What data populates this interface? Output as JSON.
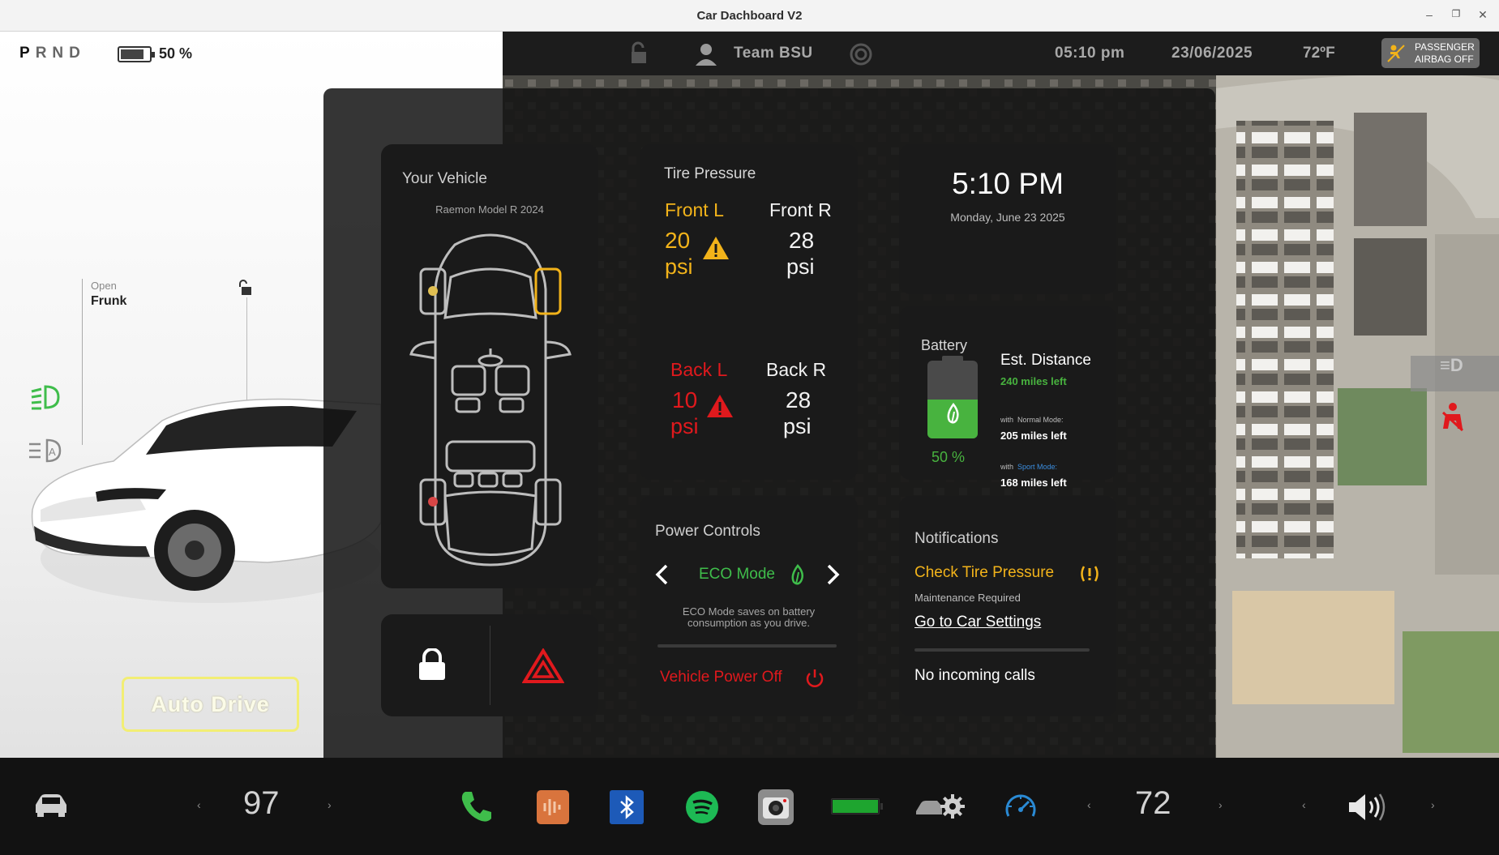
{
  "window": {
    "title": "Car Dachboard V2"
  },
  "gear": {
    "letters": [
      "P",
      "R",
      "N",
      "D"
    ],
    "selected": "P"
  },
  "battery_top": {
    "label": "50 %",
    "level": 0.5
  },
  "frunk": {
    "state": "Open",
    "label": "Frunk"
  },
  "auto_drive": {
    "label": "Auto Drive"
  },
  "topbar": {
    "profile": "Team BSU",
    "time": "05:10 pm",
    "date": "23/06/2025",
    "temp": "72ºF",
    "airbag_line1": "PASSENGER",
    "airbag_line2": "AIRBAG OFF"
  },
  "vehicle": {
    "title": "Your Vehicle",
    "model": "Raemon Model R 2024"
  },
  "tire": {
    "title": "Tire Pressure",
    "front_l": {
      "label": "Front L",
      "value": "20",
      "unit": "psi",
      "status": "warning"
    },
    "front_r": {
      "label": "Front R",
      "value": "28",
      "unit": "psi",
      "status": "ok"
    },
    "back_l": {
      "label": "Back L",
      "value": "10",
      "unit": "psi",
      "status": "critical"
    },
    "back_r": {
      "label": "Back R",
      "value": "28",
      "unit": "psi",
      "status": "ok"
    }
  },
  "clock": {
    "time": "5:10 PM",
    "date": "Monday, June 23 2025"
  },
  "battery": {
    "title": "Battery",
    "percent": "50 %",
    "level": 0.5,
    "est_title": "Est. Distance",
    "est_value": "240 miles left",
    "normal_prefix": "with",
    "normal_mode": "Normal Mode:",
    "normal_value": "205 miles left",
    "sport_prefix": "with",
    "sport_mode": "Sport Mode:",
    "sport_value": "168 miles left"
  },
  "power": {
    "title": "Power Controls",
    "mode": "ECO Mode",
    "desc_line1": "ECO Mode saves on battery",
    "desc_line2": "consumption as you drive.",
    "power_off": "Vehicle Power Off"
  },
  "notifications": {
    "title": "Notifications",
    "alert": "Check Tire Pressure",
    "sub": "Maintenance Required",
    "link": "Go to Car Settings",
    "calls": "No incoming calls"
  },
  "bottom": {
    "left_temp": "97",
    "right_temp": "72"
  },
  "colors": {
    "accent_yellow": "#f2b31a",
    "warning_red": "#e0191d",
    "eco_green": "#3fbd4b",
    "link_blue": "#3b8ee0",
    "battery_green": "#48b33f"
  }
}
